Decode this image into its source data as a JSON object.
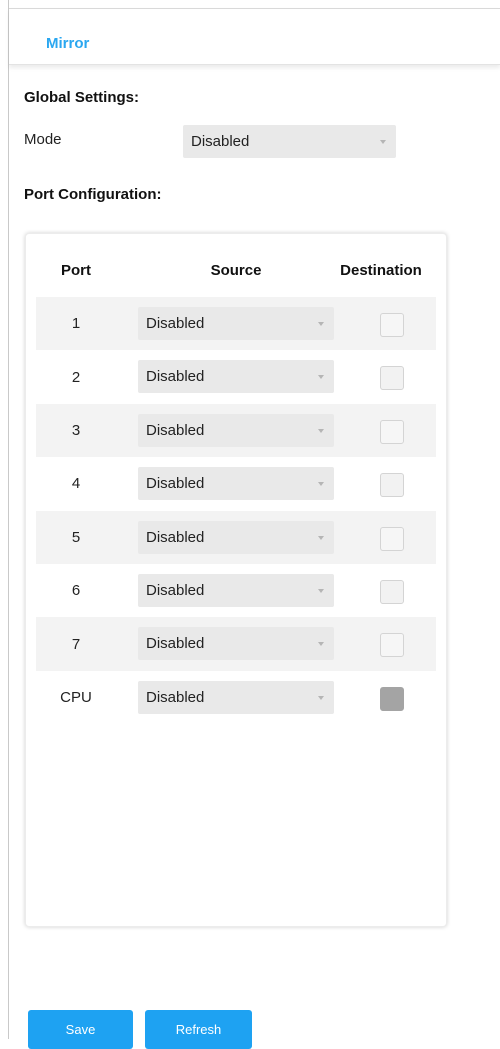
{
  "tab": {
    "title": "Mirror"
  },
  "global": {
    "title": "Global Settings:",
    "mode_label": "Mode",
    "mode_value": "Disabled"
  },
  "ports": {
    "title": "Port Configuration:",
    "headers": {
      "port": "Port",
      "source": "Source",
      "destination": "Destination"
    },
    "rows": [
      {
        "port": "1",
        "source": "Disabled",
        "destination": false
      },
      {
        "port": "2",
        "source": "Disabled",
        "destination": false
      },
      {
        "port": "3",
        "source": "Disabled",
        "destination": false
      },
      {
        "port": "4",
        "source": "Disabled",
        "destination": false
      },
      {
        "port": "5",
        "source": "Disabled",
        "destination": false
      },
      {
        "port": "6",
        "source": "Disabled",
        "destination": false
      },
      {
        "port": "7",
        "source": "Disabled",
        "destination": false
      },
      {
        "port": "CPU",
        "source": "Disabled",
        "destination": "disabled"
      }
    ]
  },
  "buttons": {
    "save": "Save",
    "refresh": "Refresh"
  },
  "colors": {
    "accent": "#1ea2f2",
    "tab_title": "#2aa7f0"
  }
}
